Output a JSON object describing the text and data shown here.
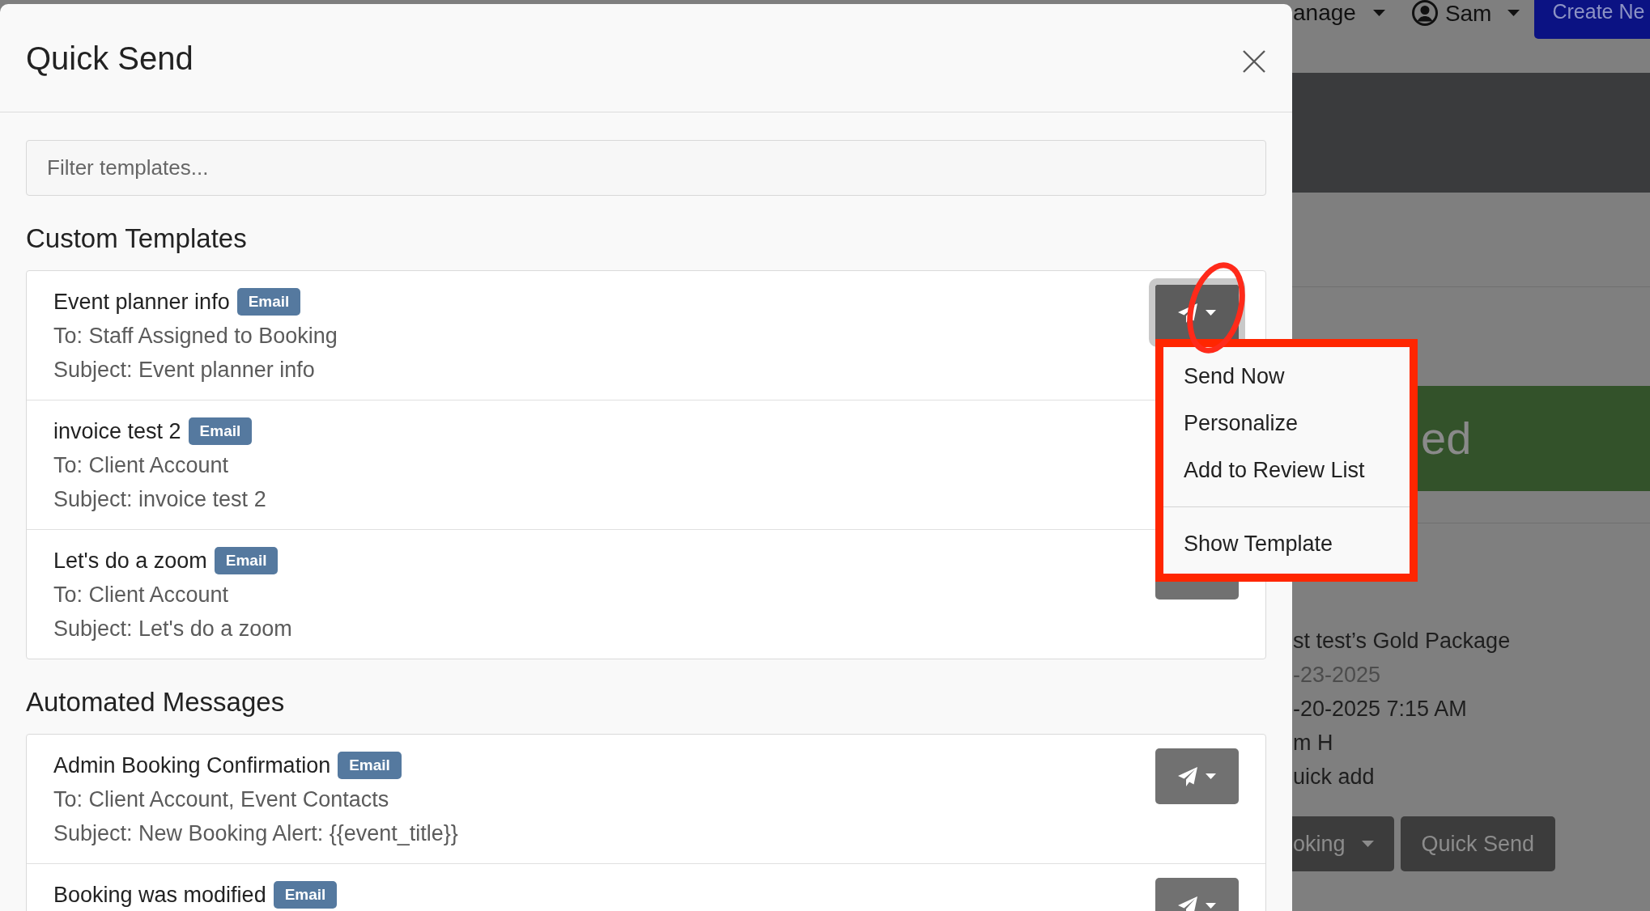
{
  "backdrop": {
    "nav_menu": "anage",
    "user_name": "Sam",
    "create_button": "Create Ne",
    "banner": "ed",
    "details": [
      {
        "text": "st test’s Gold Package",
        "muted": false
      },
      {
        "text": "-23-2025",
        "muted": true
      },
      {
        "text": "-20-2025 7:15 AM",
        "muted": false
      },
      {
        "text": "m H",
        "muted": false
      },
      {
        "text": "uick add",
        "muted": false
      }
    ],
    "buttons": [
      {
        "label": "oking",
        "kind": "dropdown"
      },
      {
        "label": "Quick Send",
        "kind": "plain"
      }
    ]
  },
  "modal": {
    "title": "Quick Send",
    "filter": {
      "placeholder": "Filter templates..."
    },
    "sections": [
      {
        "heading": "Custom Templates",
        "templates": [
          {
            "name": "Event planner info",
            "badge": "Email",
            "to": "To: Staff Assigned to Booking",
            "subject": "Subject: Event planner info",
            "send_button": {
              "open": true,
              "circled": true,
              "menu": {
                "framed": true,
                "items": [
                  {
                    "kind": "item",
                    "label": "Send Now"
                  },
                  {
                    "kind": "item",
                    "label": "Personalize"
                  },
                  {
                    "kind": "item",
                    "label": "Add to Review List"
                  },
                  {
                    "kind": "divider"
                  },
                  {
                    "kind": "item",
                    "label": "Show Template"
                  }
                ]
              }
            }
          },
          {
            "name": "invoice test 2",
            "badge": "Email",
            "to": "To: Client Account",
            "subject": "Subject: invoice test 2"
          },
          {
            "name": "Let's do a zoom",
            "badge": "Email",
            "to": "To: Client Account",
            "subject": "Subject: Let's do a zoom",
            "send_button": {
              "open": false,
              "circled": false
            }
          }
        ]
      },
      {
        "heading": "Automated Messages",
        "templates": [
          {
            "name": "Admin Booking Confirmation",
            "badge": "Email",
            "to": "To: Client Account, Event Contacts",
            "subject": "Subject: New Booking Alert: {{event_title}}",
            "send_button": {
              "open": false,
              "circled": false
            }
          },
          {
            "name": "Booking was modified",
            "badge": "Email",
            "send_button": {
              "open": false,
              "circled": false
            }
          }
        ]
      }
    ]
  }
}
